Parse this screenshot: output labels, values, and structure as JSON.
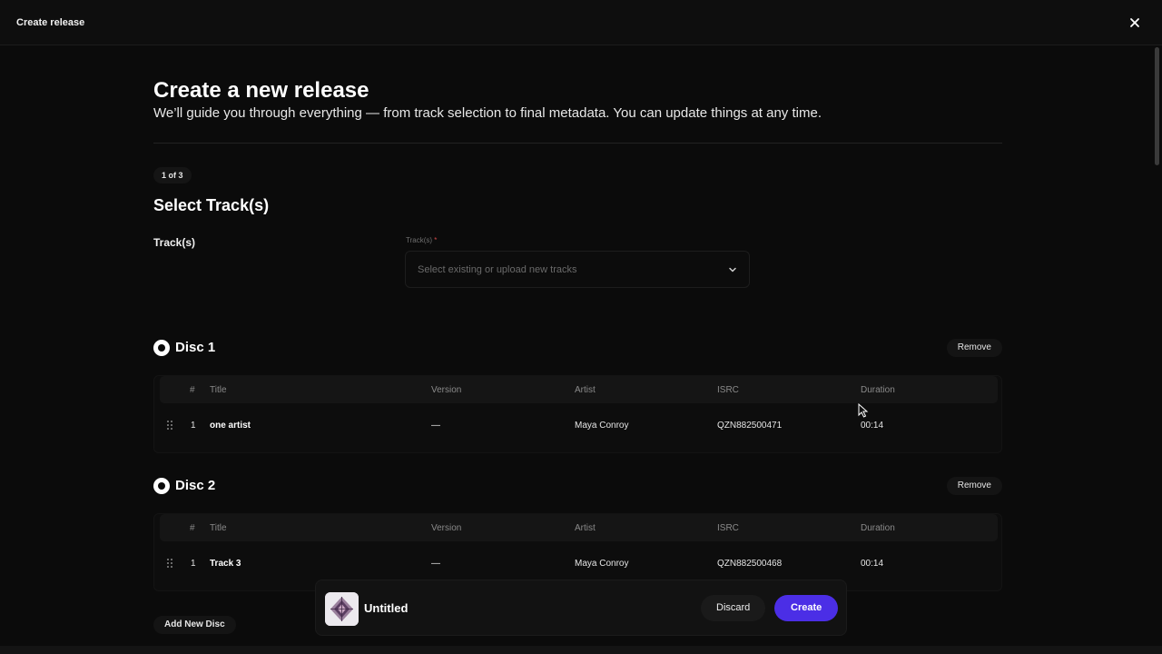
{
  "window": {
    "title": "Create release"
  },
  "header": {
    "title": "Create a new release",
    "subtitle": "We’ll guide you through everything — from track selection to final metadata. You can update things at any time."
  },
  "step": {
    "badge": "1 of 3",
    "title": "Select Track(s)"
  },
  "tracks_field": {
    "label": "Track(s)",
    "select_label": "Track(s)",
    "required_mark": "*",
    "placeholder": "Select existing or upload new tracks"
  },
  "columns": [
    "#",
    "Title",
    "Version",
    "Artist",
    "ISRC",
    "Duration"
  ],
  "discs": [
    {
      "title": "Disc 1",
      "remove_label": "Remove",
      "tracks": [
        {
          "num": "1",
          "title": "one artist",
          "version": "—",
          "artist": "Maya Conroy",
          "isrc": "QZN882500471",
          "duration": "00:14"
        }
      ]
    },
    {
      "title": "Disc 2",
      "remove_label": "Remove",
      "tracks": [
        {
          "num": "1",
          "title": "Track 3",
          "version": "—",
          "artist": "Maya Conroy",
          "isrc": "QZN882500468",
          "duration": "00:14"
        }
      ]
    }
  ],
  "add_disc_label": "Add New Disc",
  "footer": {
    "release_name": "Untitled",
    "discard_label": "Discard",
    "create_label": "Create"
  },
  "colors": {
    "accent": "#4b2ee6",
    "background": "#0b0b0b",
    "required": "#d24a4a"
  },
  "icons": {
    "close": "close-icon",
    "chevron": "chevron-down-icon",
    "disc": "disc-icon",
    "drag": "drag-handle-icon"
  }
}
